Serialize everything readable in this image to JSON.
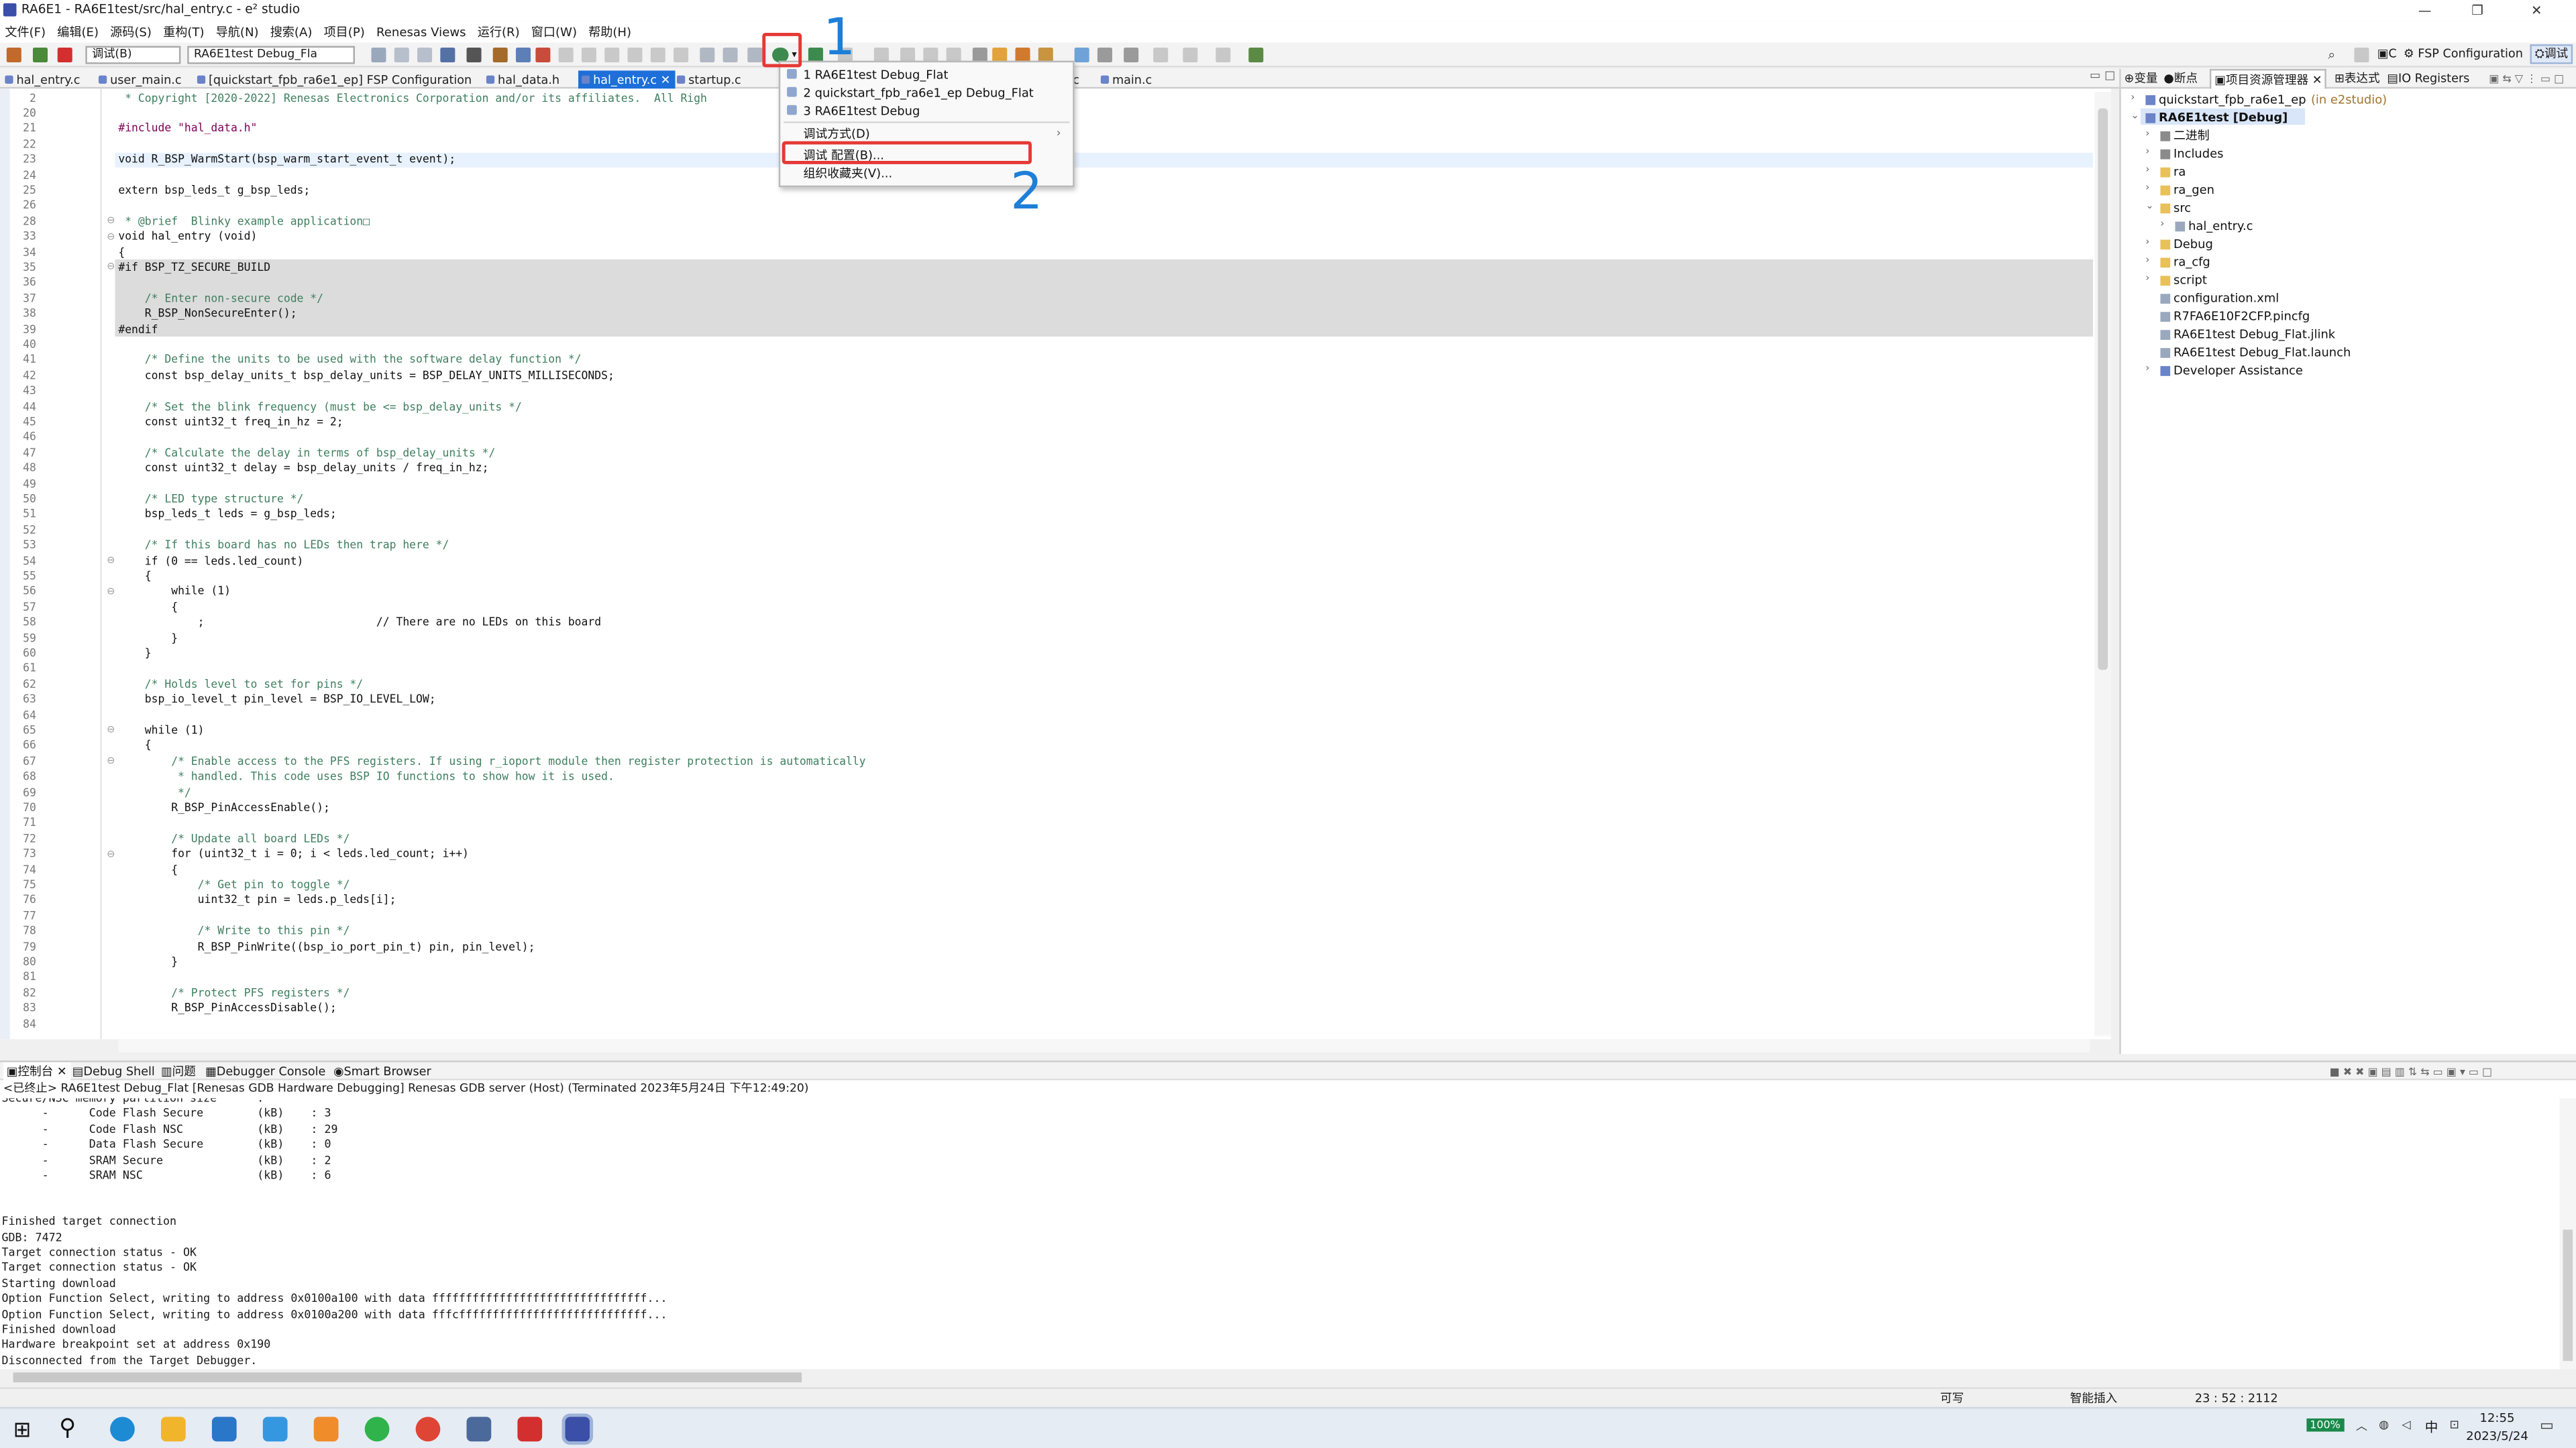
{
  "window": {
    "title": "RA6E1 - RA6E1test/src/hal_entry.c - e² studio",
    "controls": [
      "—",
      "❐",
      "✕"
    ]
  },
  "menu": [
    "文件(F)",
    "编辑(E)",
    "源码(S)",
    "重构(T)",
    "导航(N)",
    "搜索(A)",
    "项目(P)",
    "Renesas Views",
    "运行(R)",
    "窗口(W)",
    "帮助(H)"
  ],
  "toolbar": {
    "mode_combo": "调试(B)",
    "config_combo": "RA6E1test Debug_Fla"
  },
  "editor_tabs": [
    {
      "label": "hal_entry.c",
      "active": false
    },
    {
      "label": "user_main.c",
      "active": false
    },
    {
      "label": "[quickstart_fpb_ra6e1_ep] FSP Configuration",
      "active": false
    },
    {
      "label": "hal_data.h",
      "active": false
    },
    {
      "label": "hal_entry.c",
      "active": true
    },
    {
      "label": "startup.c",
      "active": false
    },
    {
      "label": "c",
      "active": false
    },
    {
      "label": "main.c",
      "active": false
    }
  ],
  "editor": {
    "lines": [
      {
        "n": "2",
        "t": " * Copyright [2020-2022] Renesas Electronics Corporation and/or its affiliates.  All Righ",
        "c": "cm",
        "i": 0
      },
      {
        "n": "20",
        "t": "",
        "i": 1
      },
      {
        "n": "21",
        "t": "#include \"hal_data.h\"",
        "c": "inc",
        "i": 2
      },
      {
        "n": "22",
        "t": "",
        "i": 3
      },
      {
        "n": "23",
        "t": "void R_BSP_WarmStart(bsp_warm_start_event_t event);",
        "cur": true,
        "i": 4
      },
      {
        "n": "24",
        "t": "",
        "i": 5
      },
      {
        "n": "25",
        "t": "extern bsp_leds_t g_bsp_leds;",
        "i": 6
      },
      {
        "n": "26",
        "t": "",
        "i": 7
      },
      {
        "n": "28",
        "t": " * @brief  Blinky example application□",
        "c": "cm",
        "i": 8
      },
      {
        "n": "33",
        "t": "void hal_entry (void)",
        "i": 9
      },
      {
        "n": "34",
        "t": "{",
        "i": 10
      },
      {
        "n": "35",
        "t": "#if BSP_TZ_SECURE_BUILD",
        "ifdef": true,
        "i": 11
      },
      {
        "n": "36",
        "t": "",
        "ifdef": true,
        "i": 12
      },
      {
        "n": "37",
        "t": "    /* Enter non-secure code */",
        "c": "cm",
        "ifdef": true,
        "i": 13
      },
      {
        "n": "38",
        "t": "    R_BSP_NonSecureEnter();",
        "ifdef": true,
        "i": 14
      },
      {
        "n": "39",
        "t": "#endif",
        "ifdef": true,
        "i": 15
      },
      {
        "n": "40",
        "t": "",
        "i": 16
      },
      {
        "n": "41",
        "t": "    /* Define the units to be used with the software delay function */",
        "c": "cm",
        "i": 17
      },
      {
        "n": "42",
        "t": "    const bsp_delay_units_t bsp_delay_units = BSP_DELAY_UNITS_MILLISECONDS;",
        "i": 18
      },
      {
        "n": "43",
        "t": "",
        "i": 19
      },
      {
        "n": "44",
        "t": "    /* Set the blink frequency (must be <= bsp_delay_units */",
        "c": "cm",
        "i": 20
      },
      {
        "n": "45",
        "t": "    const uint32_t freq_in_hz = 2;",
        "i": 21
      },
      {
        "n": "46",
        "t": "",
        "i": 22
      },
      {
        "n": "47",
        "t": "    /* Calculate the delay in terms of bsp_delay_units */",
        "c": "cm",
        "i": 23
      },
      {
        "n": "48",
        "t": "    const uint32_t delay = bsp_delay_units / freq_in_hz;",
        "i": 24
      },
      {
        "n": "49",
        "t": "",
        "i": 25
      },
      {
        "n": "50",
        "t": "    /* LED type structure */",
        "c": "cm",
        "i": 26
      },
      {
        "n": "51",
        "t": "    bsp_leds_t leds = g_bsp_leds;",
        "i": 27
      },
      {
        "n": "52",
        "t": "",
        "i": 28
      },
      {
        "n": "53",
        "t": "    /* If this board has no LEDs then trap here */",
        "c": "cm",
        "i": 29
      },
      {
        "n": "54",
        "t": "    if (0 == leds.led_count)",
        "i": 30
      },
      {
        "n": "55",
        "t": "    {",
        "i": 31
      },
      {
        "n": "56",
        "t": "        while (1)",
        "i": 32
      },
      {
        "n": "57",
        "t": "        {",
        "i": 33
      },
      {
        "n": "58",
        "t": "            ;                          // There are no LEDs on this board",
        "i": 34
      },
      {
        "n": "59",
        "t": "        }",
        "i": 35
      },
      {
        "n": "60",
        "t": "    }",
        "i": 36
      },
      {
        "n": "61",
        "t": "",
        "i": 37
      },
      {
        "n": "62",
        "t": "    /* Holds level to set for pins */",
        "c": "cm",
        "i": 38
      },
      {
        "n": "63",
        "t": "    bsp_io_level_t pin_level = BSP_IO_LEVEL_LOW;",
        "i": 39
      },
      {
        "n": "64",
        "t": "",
        "i": 40
      },
      {
        "n": "65",
        "t": "    while (1)",
        "i": 41
      },
      {
        "n": "66",
        "t": "    {",
        "i": 42
      },
      {
        "n": "67",
        "t": "        /* Enable access to the PFS registers. If using r_ioport module then register protection is automatically",
        "c": "cm",
        "i": 43
      },
      {
        "n": "68",
        "t": "         * handled. This code uses BSP IO functions to show how it is used.",
        "c": "cm",
        "i": 44
      },
      {
        "n": "69",
        "t": "         */",
        "c": "cm",
        "i": 45
      },
      {
        "n": "70",
        "t": "        R_BSP_PinAccessEnable();",
        "i": 46
      },
      {
        "n": "71",
        "t": "",
        "i": 47
      },
      {
        "n": "72",
        "t": "        /* Update all board LEDs */",
        "c": "cm",
        "i": 48
      },
      {
        "n": "73",
        "t": "        for (uint32_t i = 0; i < leds.led_count; i++)",
        "i": 49
      },
      {
        "n": "74",
        "t": "        {",
        "i": 50
      },
      {
        "n": "75",
        "t": "            /* Get pin to toggle */",
        "c": "cm",
        "i": 51
      },
      {
        "n": "76",
        "t": "            uint32_t pin = leds.p_leds[i];",
        "i": 52
      },
      {
        "n": "77",
        "t": "",
        "i": 53
      },
      {
        "n": "78",
        "t": "            /* Write to this pin */",
        "c": "cm",
        "i": 54
      },
      {
        "n": "79",
        "t": "            R_BSP_PinWrite((bsp_io_port_pin_t) pin, pin_level);",
        "i": 55
      },
      {
        "n": "80",
        "t": "        }",
        "i": 56
      },
      {
        "n": "81",
        "t": "",
        "i": 57
      },
      {
        "n": "82",
        "t": "        /* Protect PFS registers */",
        "c": "cm",
        "i": 58
      },
      {
        "n": "83",
        "t": "        R_BSP_PinAccessDisable();",
        "i": 59
      },
      {
        "n": "84",
        "t": "",
        "i": 60
      }
    ]
  },
  "launch_menu": {
    "history": [
      "1 RA6E1test Debug_Flat",
      "2 quickstart_fpb_ra6e1_ep Debug_Flat",
      "3 RA6E1test Debug"
    ],
    "debug_as": "调试方式(D)",
    "debug_config": "调试 配置(B)...",
    "organize": "组织收藏夹(V)..."
  },
  "annotations": {
    "step1": "1",
    "step2": "2",
    "color": "#1e7fd8",
    "box_color": "#e53935"
  },
  "right_panel": {
    "tabs": [
      "变量",
      "断点",
      "项目资源管理器",
      "表达式",
      "IO Registers"
    ],
    "perspectives": [
      "C",
      "FSP Configuration",
      "调试"
    ],
    "tree": [
      {
        "label": "quickstart_fpb_ra6e1_ep",
        "suffix": "(in e2studio)",
        "depth": 0,
        "twisty": "›",
        "icon": "project"
      },
      {
        "label": "RA6E1test [Debug]",
        "suffix": "",
        "depth": 0,
        "twisty": "⌄",
        "icon": "project",
        "bold": true
      },
      {
        "label": "二进制",
        "depth": 1,
        "twisty": "›",
        "icon": "binary"
      },
      {
        "label": "Includes",
        "depth": 1,
        "twisty": "›",
        "icon": "includes"
      },
      {
        "label": "ra",
        "depth": 1,
        "twisty": "›",
        "icon": "folder"
      },
      {
        "label": "ra_gen",
        "depth": 1,
        "twisty": "›",
        "icon": "folder"
      },
      {
        "label": "src",
        "depth": 1,
        "twisty": "⌄",
        "icon": "folder"
      },
      {
        "label": "hal_entry.c",
        "depth": 2,
        "twisty": "›",
        "icon": "file"
      },
      {
        "label": "Debug",
        "depth": 1,
        "twisty": "›",
        "icon": "folder"
      },
      {
        "label": "ra_cfg",
        "depth": 1,
        "twisty": "›",
        "icon": "folder"
      },
      {
        "label": "script",
        "depth": 1,
        "twisty": "›",
        "icon": "folder"
      },
      {
        "label": "configuration.xml",
        "depth": 1,
        "twisty": "",
        "icon": "file"
      },
      {
        "label": "R7FA6E10F2CFP.pincfg",
        "depth": 1,
        "twisty": "",
        "icon": "file"
      },
      {
        "label": "RA6E1test Debug_Flat.jlink",
        "depth": 1,
        "twisty": "",
        "icon": "file"
      },
      {
        "label": "RA6E1test Debug_Flat.launch",
        "depth": 1,
        "twisty": "",
        "icon": "file"
      },
      {
        "label": "Developer Assistance",
        "depth": 1,
        "twisty": "›",
        "icon": "help"
      }
    ]
  },
  "console": {
    "tabs": [
      "控制台",
      "Debug Shell",
      "问题",
      "Debugger Console",
      "Smart Browser"
    ],
    "status": "<已终止> RA6E1test Debug_Flat [Renesas GDB Hardware Debugging] Renesas GDB server (Host) (Terminated 2023年5月24日 下午12:49:20)",
    "lines": [
      "Secure/NSC memory partition size      :",
      "      -      Code Flash Secure        (kB)    : 3",
      "      -      Code Flash NSC           (kB)    : 29",
      "      -      Data Flash Secure        (kB)    : 0",
      "      -      SRAM Secure              (kB)    : 2",
      "      -      SRAM NSC                 (kB)    : 6",
      "",
      "",
      "Finished target connection",
      "GDB: 7472",
      "Target connection status - OK",
      "Target connection status - OK",
      "Starting download",
      "Option Function Select, writing to address 0x0100a100 with data ffffffffffffffffffffffffffffffff...",
      "Option Function Select, writing to address 0x0100a200 with data fffcffffffffffffffffffffffffffff...",
      "Finished download",
      "Hardware breakpoint set at address 0x190",
      "Disconnected from the Target Debugger."
    ]
  },
  "statusbar": {
    "writable": "可写",
    "insert_mode": "智能插入",
    "position": "23 : 52 : 2112"
  },
  "taskbar": {
    "battery": "100%",
    "ime": "中",
    "time": "12:55",
    "date": "2023/5/24"
  }
}
